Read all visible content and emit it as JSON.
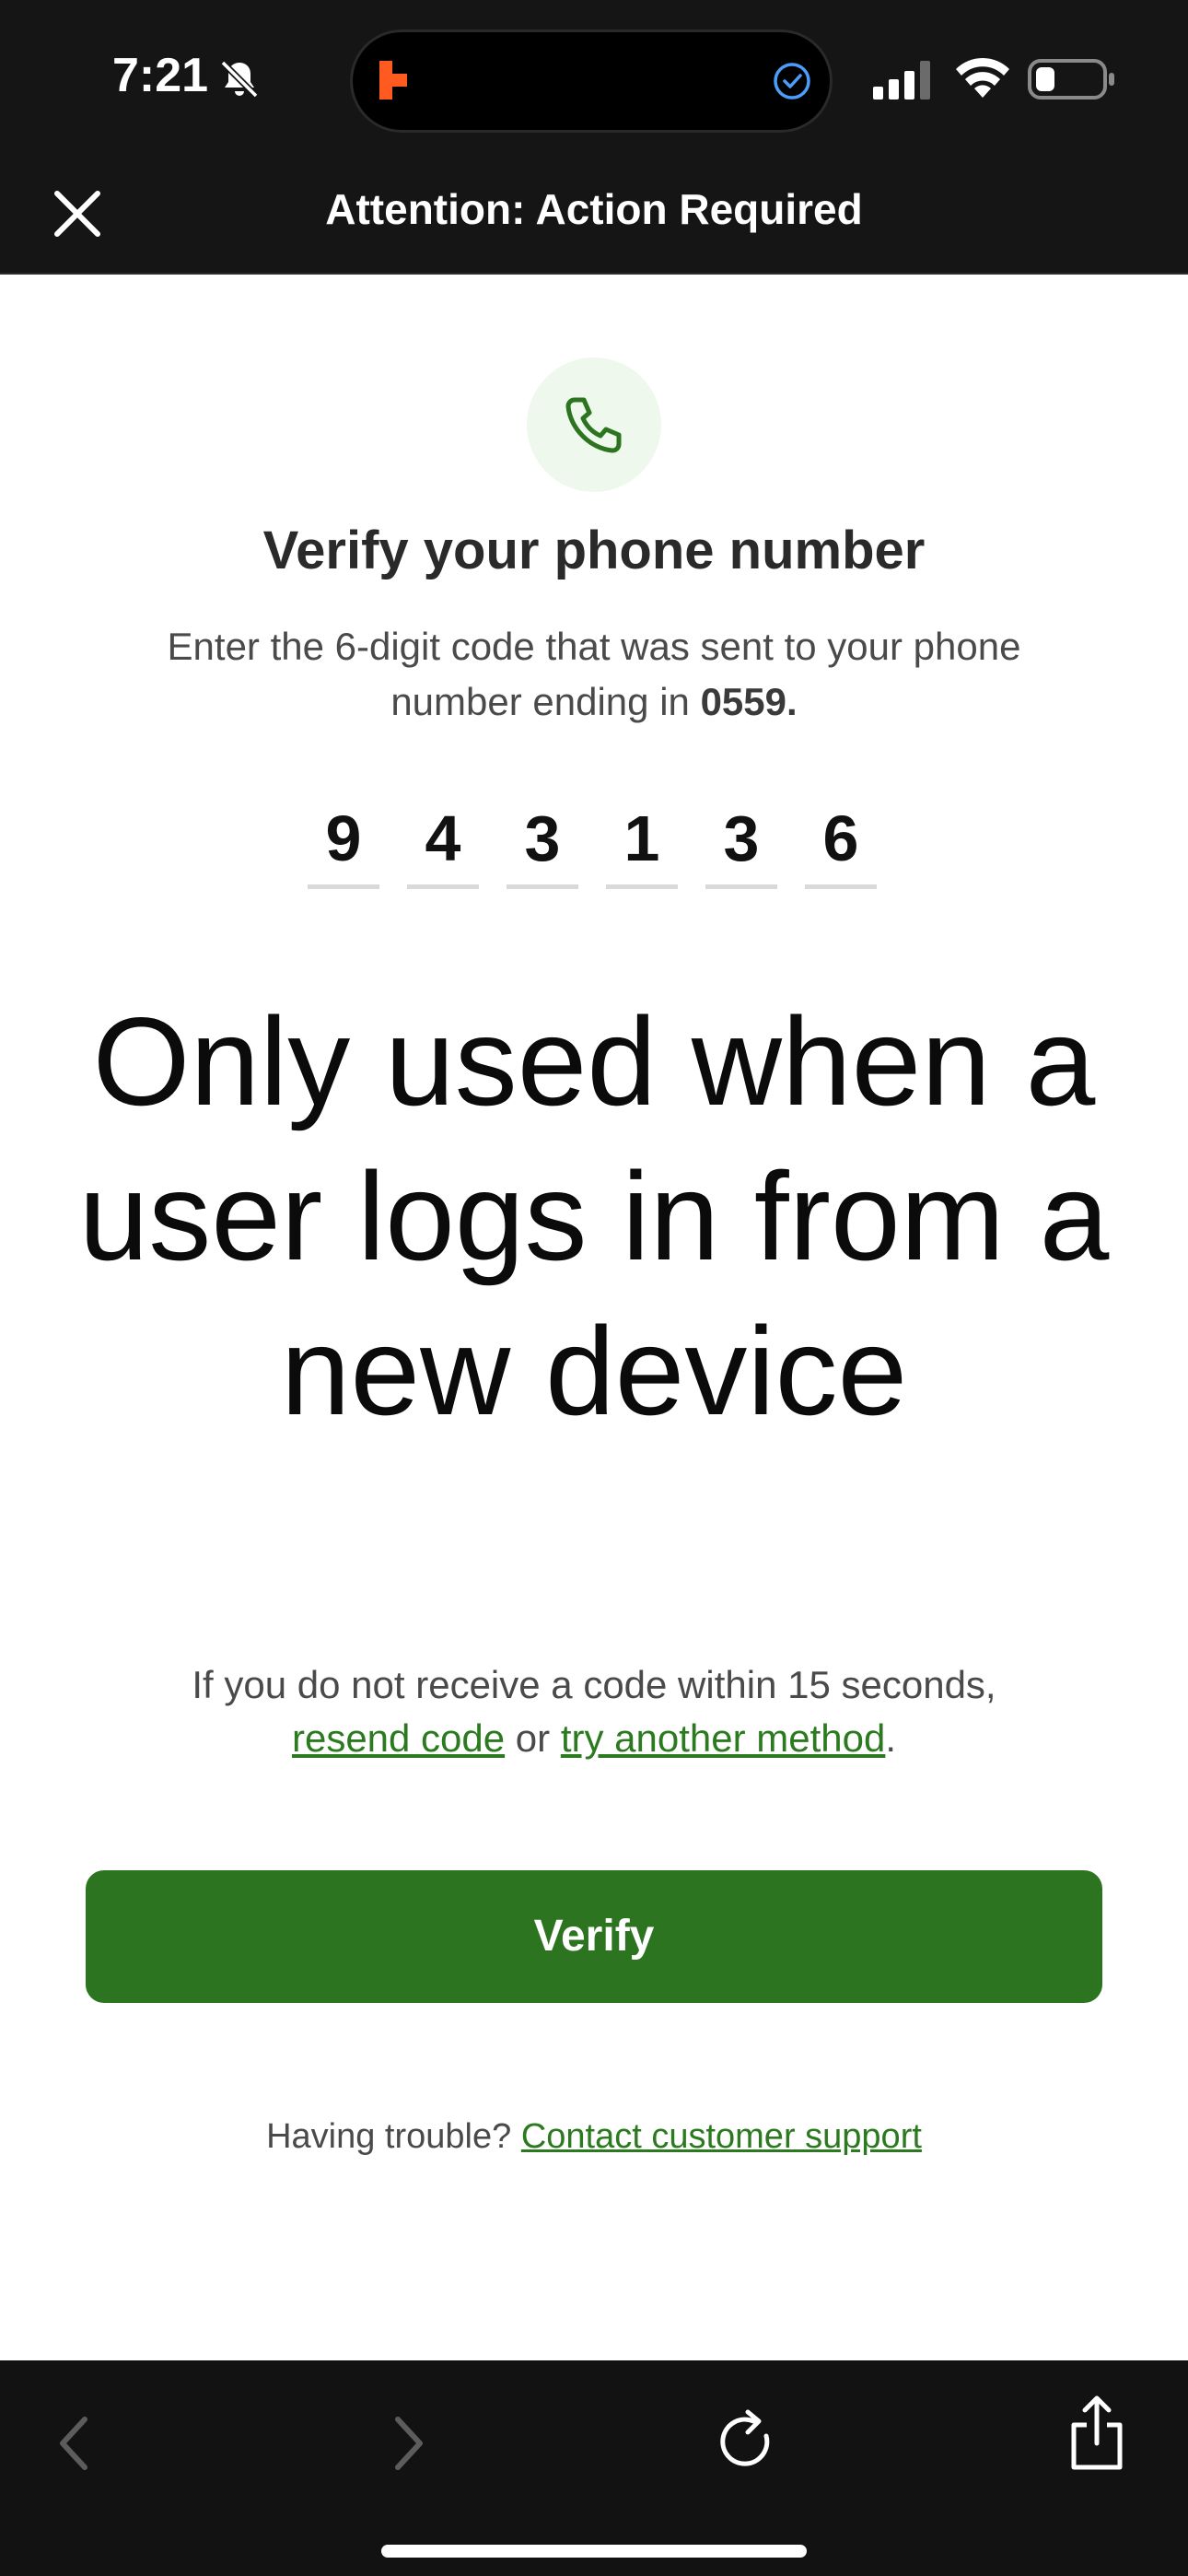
{
  "status_bar": {
    "time": "7:21",
    "icons": [
      "bell-slash-icon",
      "signal-icon",
      "wifi-icon",
      "battery-icon"
    ],
    "island_icons": [
      "app-activity-icon",
      "check-circle-icon"
    ]
  },
  "nav": {
    "title": "Attention: Action Required",
    "close_icon": "close-icon"
  },
  "main": {
    "icon": "phone-icon",
    "heading": "Verify your phone number",
    "instructions_prefix": "Enter the 6-digit code that was sent to your phone number ending in ",
    "phone_last_digits": "0559.",
    "code_digits": [
      "9",
      "4",
      "3",
      "1",
      "3",
      "6"
    ],
    "overlay_text": "Only used when a user logs in from a new device",
    "resend_prefix": "If you do not receive a code within 15 seconds,",
    "resend_link": "resend code",
    "resend_or": " or ",
    "alt_link": "try another method",
    "resend_suffix": ".",
    "verify_label": "Verify",
    "trouble_prefix": "Having trouble? ",
    "support_link": "Contact customer support"
  },
  "browser_toolbar": {
    "icons": [
      "back-icon",
      "forward-icon",
      "reload-icon",
      "share-icon"
    ]
  },
  "colors": {
    "brand_green": "#2c7420",
    "link_green": "#2b7a1f",
    "badge_bg": "#eef8ec",
    "bar_bg": "#151515"
  }
}
